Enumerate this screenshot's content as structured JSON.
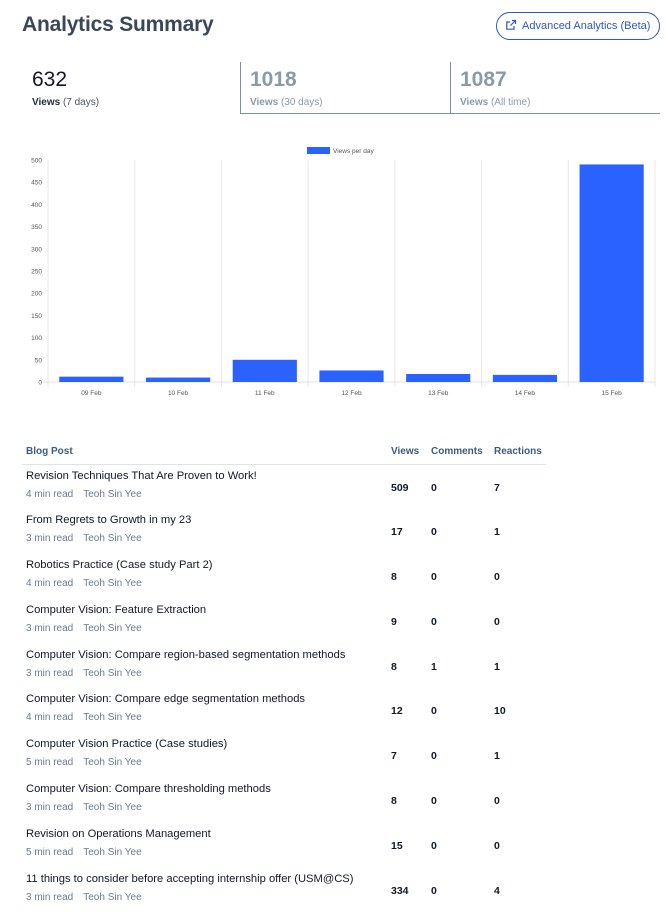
{
  "header": {
    "title": "Analytics Summary",
    "advanced_button": "Advanced Analytics (Beta)"
  },
  "stats": [
    {
      "value": "632",
      "label": "Views",
      "period": "(7 days)"
    },
    {
      "value": "1018",
      "label": "Views",
      "period": "(30 days)"
    },
    {
      "value": "1087",
      "label": "Views",
      "period": "(All time)"
    }
  ],
  "colors": {
    "bar": "#2962ff",
    "accent": "#2f57c5",
    "title": "#3b4758"
  },
  "chart_data": {
    "type": "bar",
    "categories": [
      "09 Feb",
      "10 Feb",
      "11 Feb",
      "12 Feb",
      "13 Feb",
      "14 Feb",
      "15 Feb"
    ],
    "series": [
      {
        "name": "Views per day",
        "values": [
          12,
          10,
          50,
          26,
          18,
          16,
          490
        ]
      }
    ],
    "ylim": [
      0,
      500
    ],
    "yticks": [
      0,
      50,
      100,
      150,
      200,
      250,
      300,
      350,
      400,
      450,
      500
    ],
    "legend": "top-center",
    "grid": "vertical"
  },
  "table": {
    "headers": [
      "Blog Post",
      "Views",
      "Comments",
      "Reactions"
    ],
    "rows": [
      {
        "title": "Revision Techniques That Are Proven to Work!",
        "read": "4 min read",
        "author": "Teoh Sin Yee",
        "views": "509",
        "comments": "0",
        "reactions": "7"
      },
      {
        "title": "From Regrets to Growth in my 23",
        "read": "3 min read",
        "author": "Teoh Sin Yee",
        "views": "17",
        "comments": "0",
        "reactions": "1"
      },
      {
        "title": "Robotics Practice (Case study Part 2)",
        "read": "4 min read",
        "author": "Teoh Sin Yee",
        "views": "8",
        "comments": "0",
        "reactions": "0"
      },
      {
        "title": "Computer Vision: Feature Extraction",
        "read": "3 min read",
        "author": "Teoh Sin Yee",
        "views": "9",
        "comments": "0",
        "reactions": "0"
      },
      {
        "title": "Computer Vision: Compare region-based segmentation methods",
        "read": "3 min read",
        "author": "Teoh Sin Yee",
        "views": "8",
        "comments": "1",
        "reactions": "1"
      },
      {
        "title": "Computer Vision: Compare edge segmentation methods",
        "read": "4 min read",
        "author": "Teoh Sin Yee",
        "views": "12",
        "comments": "0",
        "reactions": "10"
      },
      {
        "title": "Computer Vision Practice (Case studies)",
        "read": "5 min read",
        "author": "Teoh Sin Yee",
        "views": "7",
        "comments": "0",
        "reactions": "1"
      },
      {
        "title": "Computer Vision: Compare thresholding methods",
        "read": "3 min read",
        "author": "Teoh Sin Yee",
        "views": "8",
        "comments": "0",
        "reactions": "0"
      },
      {
        "title": "Revision on Operations Management",
        "read": "5 min read",
        "author": "Teoh Sin Yee",
        "views": "15",
        "comments": "0",
        "reactions": "0"
      },
      {
        "title": "11 things to consider before accepting internship offer (USM@CS)",
        "read": "3 min read",
        "author": "Teoh Sin Yee",
        "views": "334",
        "comments": "0",
        "reactions": "4"
      }
    ]
  }
}
